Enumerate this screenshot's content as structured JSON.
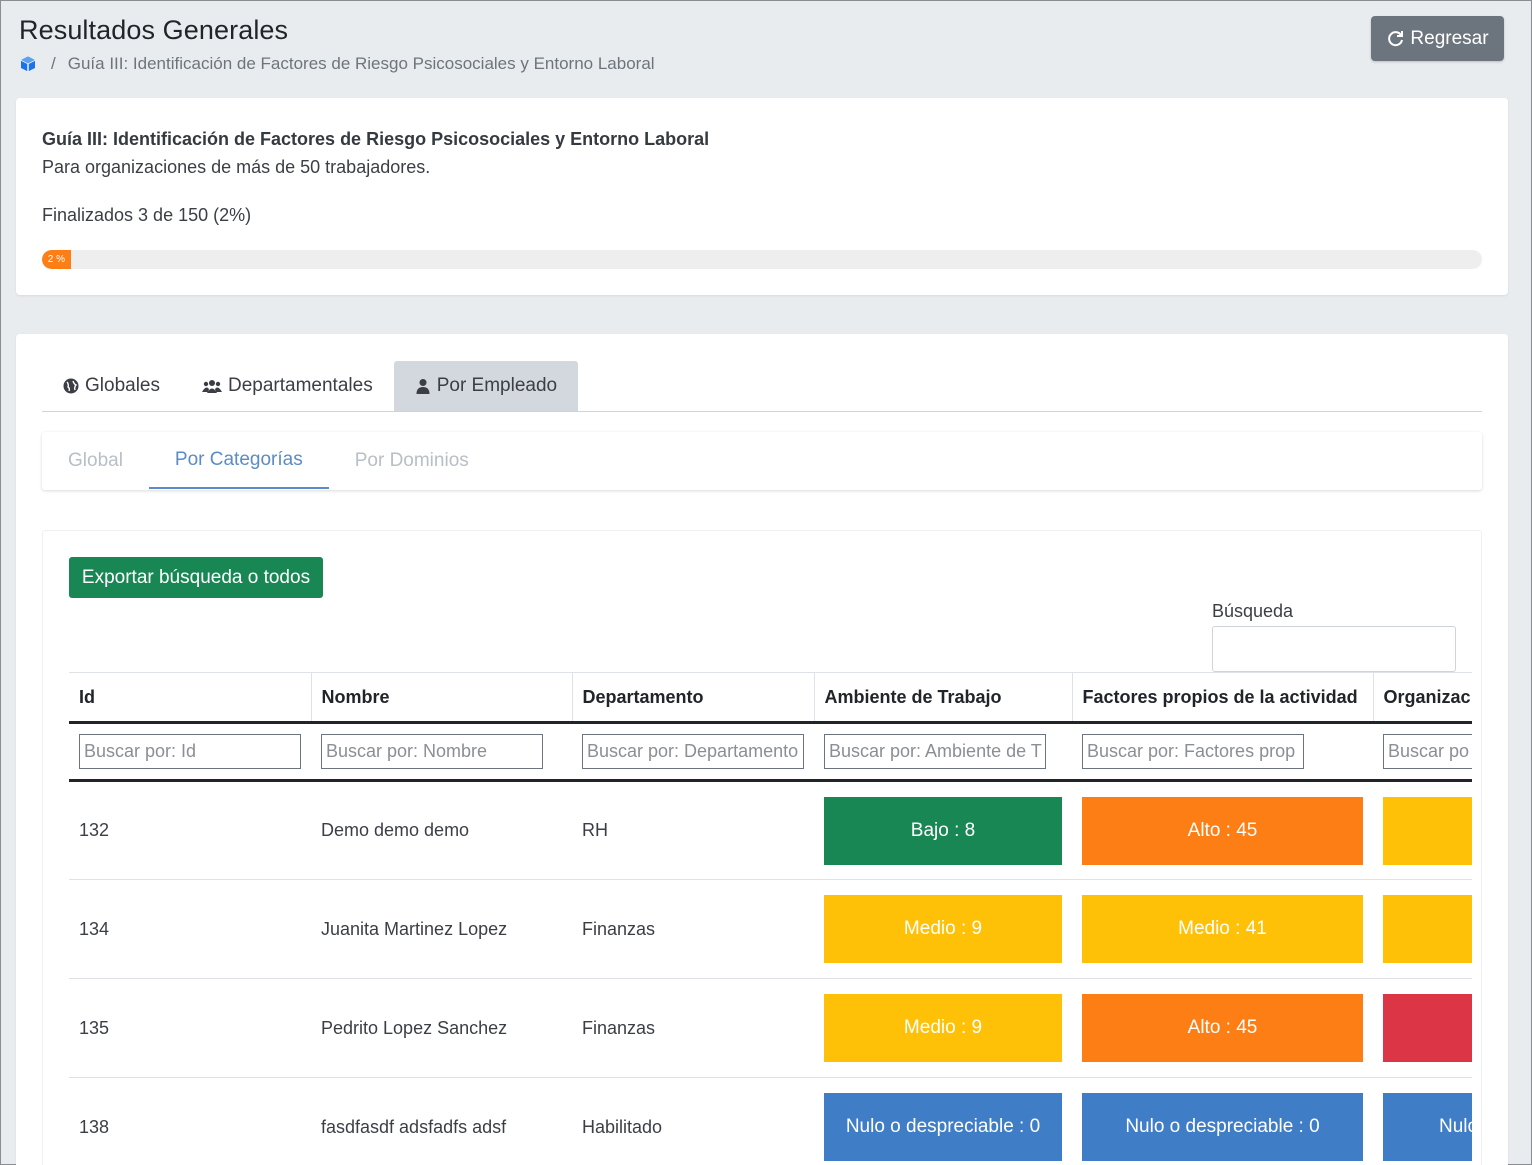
{
  "header": {
    "title": "Resultados Generales",
    "breadcrumb_sep": "/",
    "breadcrumb_current": "Guía III: Identificación de Factores de Riesgo Psicosociales y Entorno Laboral",
    "back_label": "Regresar"
  },
  "summary": {
    "title": "Guía III: Identificación de Factores de Riesgo Psicosociales y Entorno Laboral",
    "subtitle": "Para organizaciones de más de 50 trabajadores.",
    "progress_text": "Finalizados 3 de 150 (2%)",
    "progress_label": "2 %",
    "progress_percent": 2,
    "progress_color": "#fd7e14"
  },
  "tabs": [
    {
      "label": "Globales",
      "icon": "globe-icon"
    },
    {
      "label": "Departamentales",
      "icon": "users-icon"
    },
    {
      "label": "Por Empleado",
      "icon": "user-icon",
      "active": true
    }
  ],
  "subtabs": [
    {
      "label": "Global"
    },
    {
      "label": "Por Categorías",
      "active": true
    },
    {
      "label": "Por Dominios"
    }
  ],
  "export_label": "Exportar búsqueda o todos",
  "search": {
    "label": "Búsqueda",
    "value": ""
  },
  "table": {
    "columns": [
      "Id",
      "Nombre",
      "Departamento",
      "Ambiente de Trabajo",
      "Factores propios de la actividad",
      "Organizac"
    ],
    "filters": [
      "Buscar por: Id",
      "Buscar por: Nombre",
      "Buscar por: Departamento",
      "Buscar por: Ambiente de T",
      "Buscar por: Factores prop",
      "Buscar po"
    ],
    "rows": [
      {
        "id": "132",
        "nombre": "Demo demo demo",
        "departamento": "RH",
        "cells": [
          {
            "label": "Bajo : 8",
            "color": "#198754"
          },
          {
            "label": "Alto : 45",
            "color": "#fd7e14"
          },
          {
            "label": "",
            "color": "#ffc107"
          }
        ]
      },
      {
        "id": "134",
        "nombre": "Juanita Martinez Lopez",
        "departamento": "Finanzas",
        "cells": [
          {
            "label": "Medio : 9",
            "color": "#ffc107"
          },
          {
            "label": "Medio : 41",
            "color": "#ffc107"
          },
          {
            "label": "",
            "color": "#ffc107"
          }
        ]
      },
      {
        "id": "135",
        "nombre": "Pedrito Lopez Sanchez",
        "departamento": "Finanzas",
        "cells": [
          {
            "label": "Medio : 9",
            "color": "#ffc107"
          },
          {
            "label": "Alto : 45",
            "color": "#fd7e14"
          },
          {
            "label": "",
            "color": "#dc3545"
          }
        ]
      },
      {
        "id": "138",
        "nombre": "fasdfasdf adsfadfs adsf",
        "departamento": "Habilitado",
        "cells": [
          {
            "label": "Nulo o despreciable : 0",
            "color": "#3f7ec6"
          },
          {
            "label": "Nulo o despreciable : 0",
            "color": "#3f7ec6"
          },
          {
            "label": "Nulo",
            "color": "#3f7ec6"
          }
        ]
      }
    ]
  }
}
